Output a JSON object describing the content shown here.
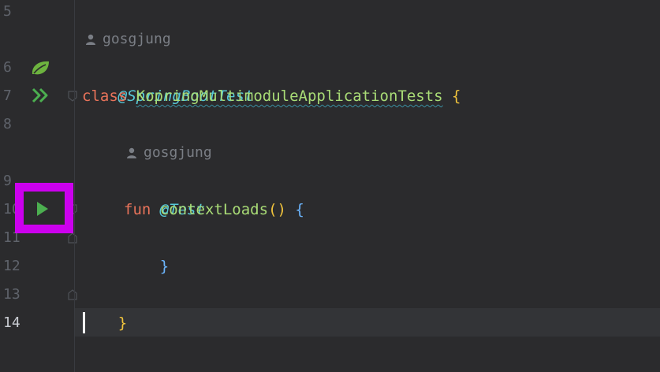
{
  "editor": {
    "line_numbers": [
      "5",
      "6",
      "7",
      "8",
      "9",
      "10",
      "11",
      "12",
      "13",
      "14"
    ],
    "current_line": "14",
    "inlay_hints": {
      "class_author": "gosgjung",
      "method_author": "gosgjung"
    },
    "code": {
      "class_annotation": "@SpringBootTest",
      "class_keyword": "class",
      "class_name": "KopringMultimoduleApplicationTests",
      "class_open_brace": "{",
      "method_annotation": "@Test",
      "fun_keyword": "fun",
      "method_name": "contextLoads",
      "method_parens": "()",
      "method_open_brace": "{",
      "method_close_brace": "}",
      "class_close_brace": "}"
    },
    "gutter_icons": {
      "line6": "spring-bean-leaf-icon",
      "line7": "run-all-tests-icon",
      "line10": "run-test-icon"
    },
    "colors": {
      "background": "#2b2b2d",
      "annotation": "#56c8d8",
      "keyword": "#e8735a",
      "identifier": "#a9dc76",
      "highlight": "#cc00ee",
      "run_icon": "#4caf50"
    }
  }
}
